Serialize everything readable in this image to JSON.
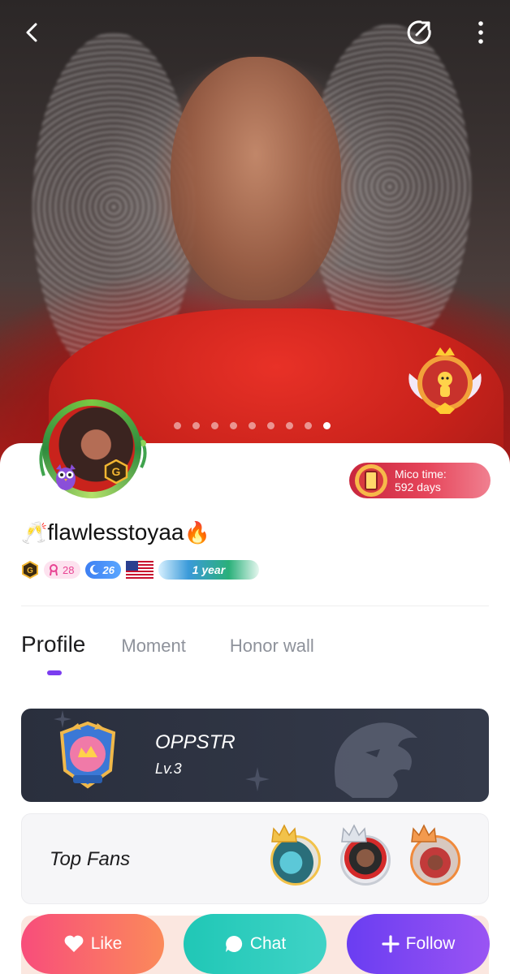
{
  "hero": {
    "photo_dots": 9,
    "active_dot": 9
  },
  "header": {
    "back_icon": "chevron-left-icon",
    "share_icon": "share-icon",
    "more_icon": "more-vertical-icon"
  },
  "profile": {
    "username": "flawlesstoyaa",
    "prefix_emoji": "🥂",
    "suffix_emoji": "🔥",
    "mico_time_label": "Mico time:",
    "mico_time_value": "592 days",
    "badges": {
      "pink_level": "28",
      "blue_level": "26",
      "country_flag": "us-flag-icon",
      "year_badge": "1 year"
    }
  },
  "tabs": [
    {
      "label": "Profile",
      "active": true
    },
    {
      "label": "Moment",
      "active": false
    },
    {
      "label": "Honor wall",
      "active": false
    }
  ],
  "family": {
    "name": "OPPSTR",
    "level": "Lv.3"
  },
  "top_fans": {
    "title": "Top Fans",
    "crown_colors": [
      "#f2c24a",
      "#c8ccd4",
      "#f08a3c"
    ]
  },
  "actions": {
    "like": "Like",
    "chat": "Chat",
    "follow": "Follow"
  },
  "colors": {
    "accent": "#7b3df0",
    "like": "#f84d7b",
    "chat": "#20c7b6",
    "follow": "#6a3df2"
  }
}
